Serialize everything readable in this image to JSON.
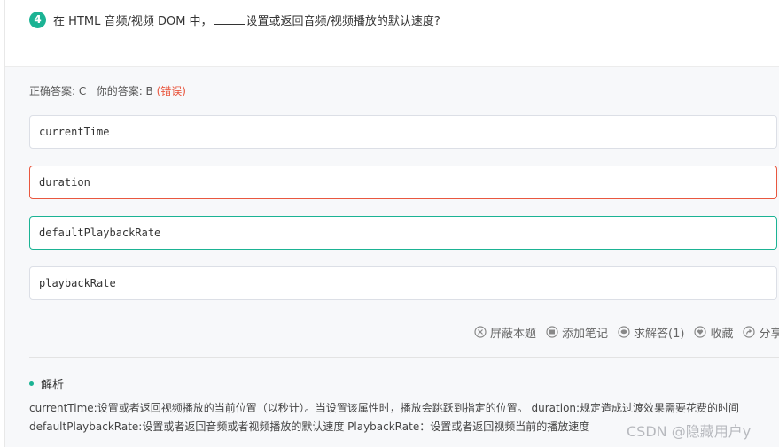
{
  "question": {
    "number": "4",
    "text_before": "在 HTML 音频/视频 DOM 中，",
    "text_after": "设置或返回音频/视频播放的默认速度?"
  },
  "answer": {
    "correct_label": "正确答案: C",
    "yours_label": "你的答案: B",
    "status": "(错误)"
  },
  "options": [
    {
      "text": "currentTime"
    },
    {
      "text": "duration"
    },
    {
      "text": "defaultPlaybackRate"
    },
    {
      "text": "playbackRate"
    }
  ],
  "actions": {
    "block": {
      "label": "屏蔽本题",
      "icon": "block-icon"
    },
    "note": {
      "label": "添加笔记",
      "icon": "note-icon"
    },
    "ask": {
      "label": "求解答(1)",
      "icon": "comment-icon"
    },
    "favorite": {
      "label": "收藏",
      "icon": "heart-icon"
    },
    "share": {
      "label": "分享",
      "icon": "share-icon"
    }
  },
  "analysis": {
    "title": "解析",
    "line1": "currentTime:设置或者返回视频播放的当前位置（以秒计）。当设置该属性时，播放会跳跃到指定的位置。 duration:规定造成过渡效果需要花费的时间",
    "line2": "defaultPlaybackRate:设置或者返回音频或者视频播放的默认速度 PlaybackRate：设置或者返回视频当前的播放速度"
  },
  "watermark": "CSDN @隐藏用户y",
  "colors": {
    "accent": "#1bb394",
    "error": "#e9573f"
  }
}
